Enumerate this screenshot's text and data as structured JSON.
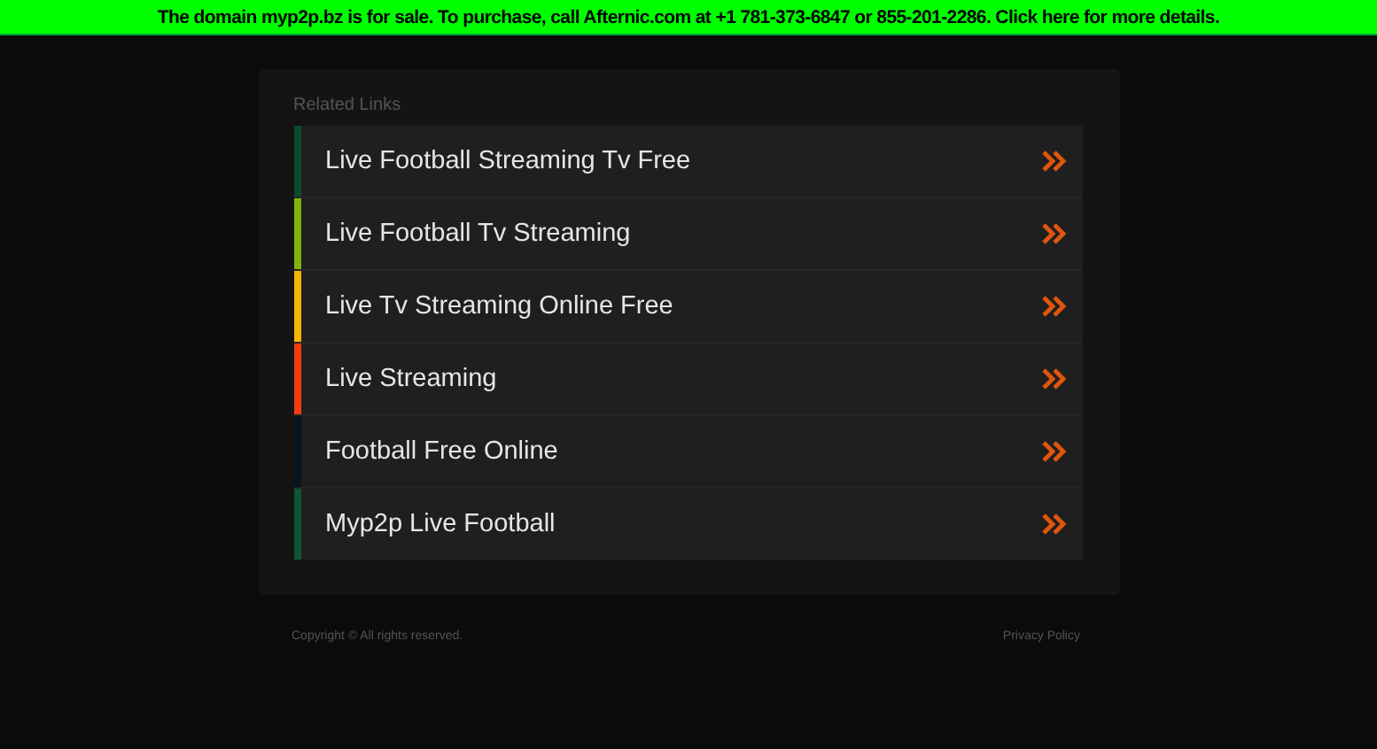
{
  "banner": {
    "text": "The domain myp2p.bz is for sale. To purchase, call Afternic.com at +1 781-373-6847 or 855-201-2286. Click here for more details."
  },
  "related_links": {
    "heading": "Related Links",
    "items": [
      {
        "label": "Live Football Streaming Tv Free",
        "color": "#0b4a2c"
      },
      {
        "label": "Live Football Tv Streaming",
        "color": "#7cb40c"
      },
      {
        "label": "Live Tv Streaming Online Free",
        "color": "#f7b500"
      },
      {
        "label": "Live Streaming",
        "color": "#f23c0a"
      },
      {
        "label": "Football Free Online",
        "color": "#08141e"
      },
      {
        "label": "Myp2p Live Football",
        "color": "#0e5534"
      }
    ]
  },
  "footer": {
    "copyright": "Copyright ©  All rights reserved.",
    "privacy": "Privacy Policy"
  }
}
